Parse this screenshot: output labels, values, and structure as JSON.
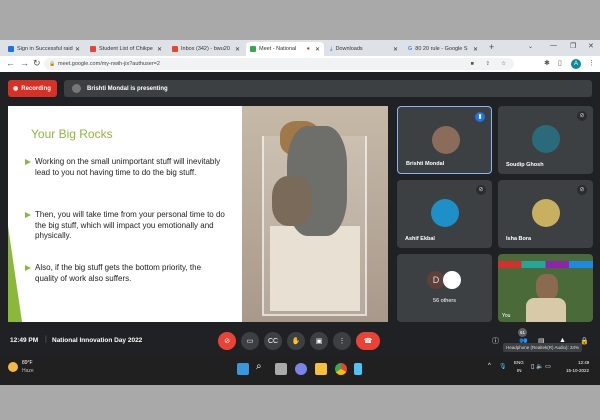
{
  "browser": {
    "tabs": [
      {
        "label": "Sign in Successful raid",
        "color": "#1a73e8"
      },
      {
        "label": "Student List of Chikpe",
        "color": "#ea4335"
      },
      {
        "label": "Inbox (342) - bwu20",
        "color": "#ea4335"
      },
      {
        "label": "Meet - National",
        "color": "#34a853"
      },
      {
        "label": "Downloads",
        "color": "#1a73e8"
      },
      {
        "label": "80 20 rule - Google S",
        "color": "#4285f4"
      }
    ],
    "new_tab": "+",
    "url": "meet.google.com/my-nwih-jix?authuser=2",
    "profile": "A"
  },
  "meet": {
    "recording_label": "Recording",
    "presenting_text": "Brishti Mondal is presenting",
    "slide": {
      "title": "Your Big Rocks",
      "bullets": [
        "Working on the small unimportant stuff will inevitably lead to you not having time to do the big stuff.",
        "Then, you will take time from your personal time to do the big stuff, which will impact you emotionally and physically.",
        "Also, if the big stuff gets the bottom priority, the quality of work also suffers."
      ]
    },
    "participants": [
      {
        "name": "Brishti Mondal",
        "speaking": true
      },
      {
        "name": "Soudip Ghosh",
        "muted": true
      },
      {
        "name": "Ashif Ekbal",
        "muted": true
      },
      {
        "name": "Isha Bora",
        "muted": true
      }
    ],
    "others": {
      "initial": "D",
      "label": "56 others"
    },
    "self_label": "You",
    "time": "12:49 PM",
    "meeting_title": "National Innovation Day 2022",
    "participant_count": "61",
    "tooltip": "Headphone (Realtek(R) Audio): 34%"
  },
  "taskbar": {
    "weather_temp": "89°F",
    "weather_desc": "Haze",
    "lang1": "ENG",
    "lang2": "IN",
    "time": "12:49",
    "date": "15-10-2022"
  }
}
